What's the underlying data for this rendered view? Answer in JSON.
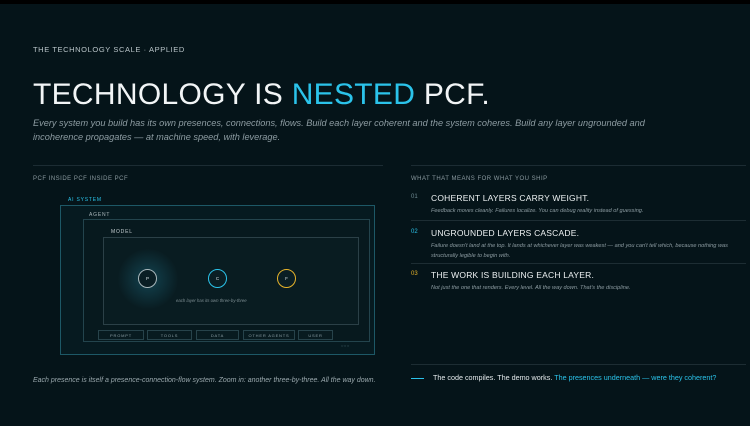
{
  "eyebrow": "THE TECHNOLOGY SCALE · APPLIED",
  "headline": {
    "part1": "TECHNOLOGY IS ",
    "accent": "NESTED",
    "part2": " PCF."
  },
  "intro": "Every system you build has its own presences, connections, flows. Build each layer coherent and the system coheres. Build any layer ungrounded and incoherence propagates — at machine speed, with leverage.",
  "left": {
    "label": "PCF INSIDE PCF INSIDE PCF",
    "diagram": {
      "ai_system": "AI SYSTEM",
      "agent": "AGENT",
      "model": "MODEL",
      "nodes": [
        "P",
        "C",
        "F"
      ],
      "inner_caption": "each layer has its own three-by-three",
      "chips": [
        "PROMPT",
        "TOOLS",
        "DATA",
        "OTHER AGENTS",
        "USER"
      ],
      "dots": "○○○"
    },
    "caption": "Each presence is itself a presence-connection-flow system. Zoom in: another three-by-three. All the way down."
  },
  "right": {
    "label": "WHAT THAT MEANS FOR WHAT YOU SHIP",
    "points": [
      {
        "num": "01",
        "title": "COHERENT LAYERS CARRY WEIGHT.",
        "desc": "Feedback moves cleanly. Failures localize. You can debug reality instead of guessing.",
        "color": "#6f8a92"
      },
      {
        "num": "02",
        "title": "UNGROUNDED LAYERS CASCADE.",
        "desc": "Failure doesn't land at the top. It lands at whichever layer was weakest — and you can't tell which, because nothing was structurally legible to begin with.",
        "color": "#2bc3ea"
      },
      {
        "num": "03",
        "title": "THE WORK IS BUILDING EACH LAYER.",
        "desc": "Not just the one that renders. Every level. All the way down. That's the discipline.",
        "color": "#e6b32a"
      }
    ],
    "closing": {
      "text": "The code compiles. The demo works. ",
      "highlight": "The presences underneath — were they coherent?"
    }
  },
  "colors": {
    "accent": "#2bc3ea",
    "gold": "#e6b32a",
    "background": "#051419"
  }
}
